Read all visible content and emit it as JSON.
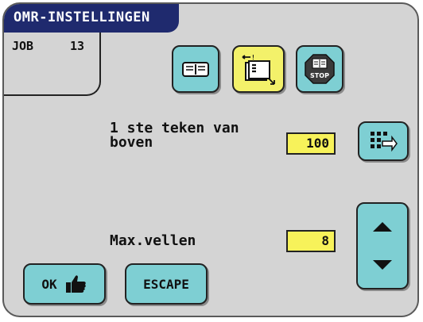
{
  "title": "OMR-INSTELLINGEN",
  "job": {
    "label": "JOB",
    "number": "13"
  },
  "tabs": [
    {
      "name": "book",
      "active": false
    },
    {
      "name": "omr-settings",
      "active": true
    },
    {
      "name": "stop",
      "active": false
    }
  ],
  "stop_icon_text": "STOP",
  "first_mark": {
    "label_line1": "1 ste teken van",
    "label_line2": "boven",
    "value": "100"
  },
  "max_sheets": {
    "label": "Max.vellen",
    "value": "8"
  },
  "buttons": {
    "ok": "OK",
    "escape": "ESCAPE"
  },
  "colors": {
    "title_bg": "#1f2a6e",
    "button": "#7ecfd3",
    "active": "#f3f16a",
    "screen": "#d4d4d4"
  }
}
